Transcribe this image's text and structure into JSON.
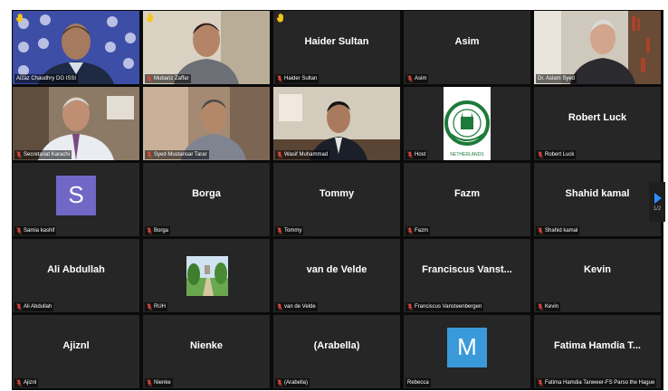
{
  "meeting": {
    "pager_label": "1/2",
    "tiles": [
      {
        "display_name": "",
        "label": "Aizaz Chaudhry DG ISSI",
        "muted": false,
        "hand": true,
        "speaking": true,
        "kind": "video",
        "photo": "man-blue-logo-backdrop"
      },
      {
        "display_name": "",
        "label": "Mubariz Zaffar",
        "muted": true,
        "hand": true,
        "speaking": false,
        "kind": "video",
        "photo": "young-man-glasses"
      },
      {
        "display_name": "Haider Sultan",
        "label": "Haider Sultan",
        "muted": true,
        "hand": true,
        "speaking": false,
        "kind": "name"
      },
      {
        "display_name": "Asim",
        "label": "Asim",
        "muted": true,
        "hand": false,
        "speaking": false,
        "kind": "name"
      },
      {
        "display_name": "",
        "label": "Dr. Aslam Syed",
        "muted": false,
        "hand": false,
        "speaking": false,
        "kind": "video",
        "photo": "elderly-man-bookshelf"
      },
      {
        "display_name": "",
        "label": "Secretariat Karachi",
        "muted": true,
        "hand": false,
        "speaking": false,
        "kind": "video",
        "photo": "man-office-beige"
      },
      {
        "display_name": "",
        "label": "Syed Mustansar Tarar",
        "muted": true,
        "hand": false,
        "speaking": false,
        "kind": "video",
        "photo": "man-blurred-room"
      },
      {
        "display_name": "",
        "label": "Wasif Muhammad",
        "muted": true,
        "hand": false,
        "speaking": false,
        "kind": "video",
        "photo": "man-suit-office"
      },
      {
        "display_name": "",
        "label": "Host",
        "muted": true,
        "hand": false,
        "speaking": false,
        "kind": "emblem",
        "emblem_text": "NETHERLANDS"
      },
      {
        "display_name": "Robert Luck",
        "label": "Robert Luck",
        "muted": true,
        "hand": false,
        "speaking": false,
        "kind": "name"
      },
      {
        "display_name": "",
        "label": "Samia kashif",
        "muted": true,
        "hand": false,
        "speaking": false,
        "kind": "avatar",
        "avatar_letter": "S",
        "avatar_color": "#7167c5"
      },
      {
        "display_name": "Borga",
        "label": "Borga",
        "muted": true,
        "hand": false,
        "speaking": false,
        "kind": "name"
      },
      {
        "display_name": "Tommy",
        "label": "Tommy",
        "muted": true,
        "hand": false,
        "speaking": false,
        "kind": "name"
      },
      {
        "display_name": "Fazm",
        "label": "Fazm",
        "muted": true,
        "hand": false,
        "speaking": false,
        "kind": "name"
      },
      {
        "display_name": "Shahid kamal",
        "label": "Shahid kamal",
        "muted": true,
        "hand": false,
        "speaking": false,
        "kind": "name"
      },
      {
        "display_name": "Ali Abdullah",
        "label": "Ali Abdullah",
        "muted": true,
        "hand": false,
        "speaking": false,
        "kind": "name"
      },
      {
        "display_name": "",
        "label": "RUH",
        "muted": true,
        "hand": false,
        "speaking": false,
        "kind": "garden"
      },
      {
        "display_name": "van de Velde",
        "label": "van de Velde",
        "muted": true,
        "hand": false,
        "speaking": false,
        "kind": "name"
      },
      {
        "display_name": "Franciscus Vanst...",
        "label": "Franciscus Vansteenbergen",
        "muted": true,
        "hand": false,
        "speaking": false,
        "kind": "name"
      },
      {
        "display_name": "Kevin",
        "label": "Kevin",
        "muted": true,
        "hand": false,
        "speaking": false,
        "kind": "name"
      },
      {
        "display_name": "Ajiznl",
        "label": "Ajiznl",
        "muted": true,
        "hand": false,
        "speaking": false,
        "kind": "name"
      },
      {
        "display_name": "Nienke",
        "label": "Nienke",
        "muted": true,
        "hand": false,
        "speaking": false,
        "kind": "name"
      },
      {
        "display_name": "(Arabella)",
        "label": "(Arabella)",
        "muted": true,
        "hand": false,
        "speaking": false,
        "kind": "name"
      },
      {
        "display_name": "",
        "label": "Rebecca",
        "muted": false,
        "hand": false,
        "speaking": false,
        "kind": "avatar",
        "avatar_letter": "M",
        "avatar_color": "#3a9ad9"
      },
      {
        "display_name": "Fatima Hamdia T...",
        "label": "Fatima Hamdia Tanweer-FS Parso the Hague",
        "muted": true,
        "hand": false,
        "speaking": false,
        "kind": "name"
      }
    ]
  },
  "colors": {
    "tile_bg": "#262626",
    "grid_bg": "#0a0a0a",
    "mute_red": "#e0473a",
    "hand_yellow": "#f5c518",
    "speaker_outline": "#c9d51c",
    "pager_arrow": "#2d8cff"
  }
}
